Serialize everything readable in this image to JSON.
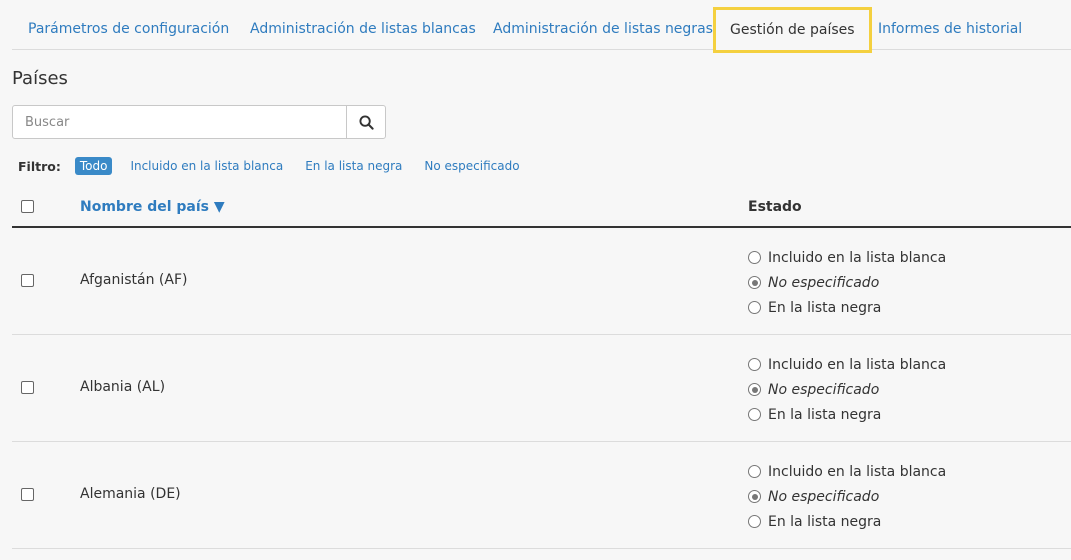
{
  "tabs": [
    {
      "label": "Parámetros de configuración"
    },
    {
      "label": "Administración de listas blancas"
    },
    {
      "label": "Administración de listas negras"
    },
    {
      "label": "Gestión de países",
      "active": true
    },
    {
      "label": "Informes de historial"
    }
  ],
  "section_title": "Países",
  "search": {
    "placeholder": "Buscar",
    "value": "",
    "button_icon": "search-icon"
  },
  "filter": {
    "label": "Filtro:",
    "options": [
      "Todo",
      "Incluido en la lista blanca",
      "En la lista negra",
      "No especificado"
    ],
    "selected": "Todo"
  },
  "table": {
    "columns": {
      "name": "Nombre del país ▼",
      "state": "Estado"
    },
    "status_options": [
      "Incluido en la lista blanca",
      "No especificado",
      "En la lista negra"
    ],
    "rows": [
      {
        "country": "Afganistán (AF)",
        "status": "No especificado"
      },
      {
        "country": "Albania (AL)",
        "status": "No especificado"
      },
      {
        "country": "Alemania (DE)",
        "status": "No especificado"
      }
    ]
  },
  "colors": {
    "link": "#2f7cbf",
    "active_filter_bg": "#3a8ac8",
    "highlight_border": "#f4d03f"
  }
}
